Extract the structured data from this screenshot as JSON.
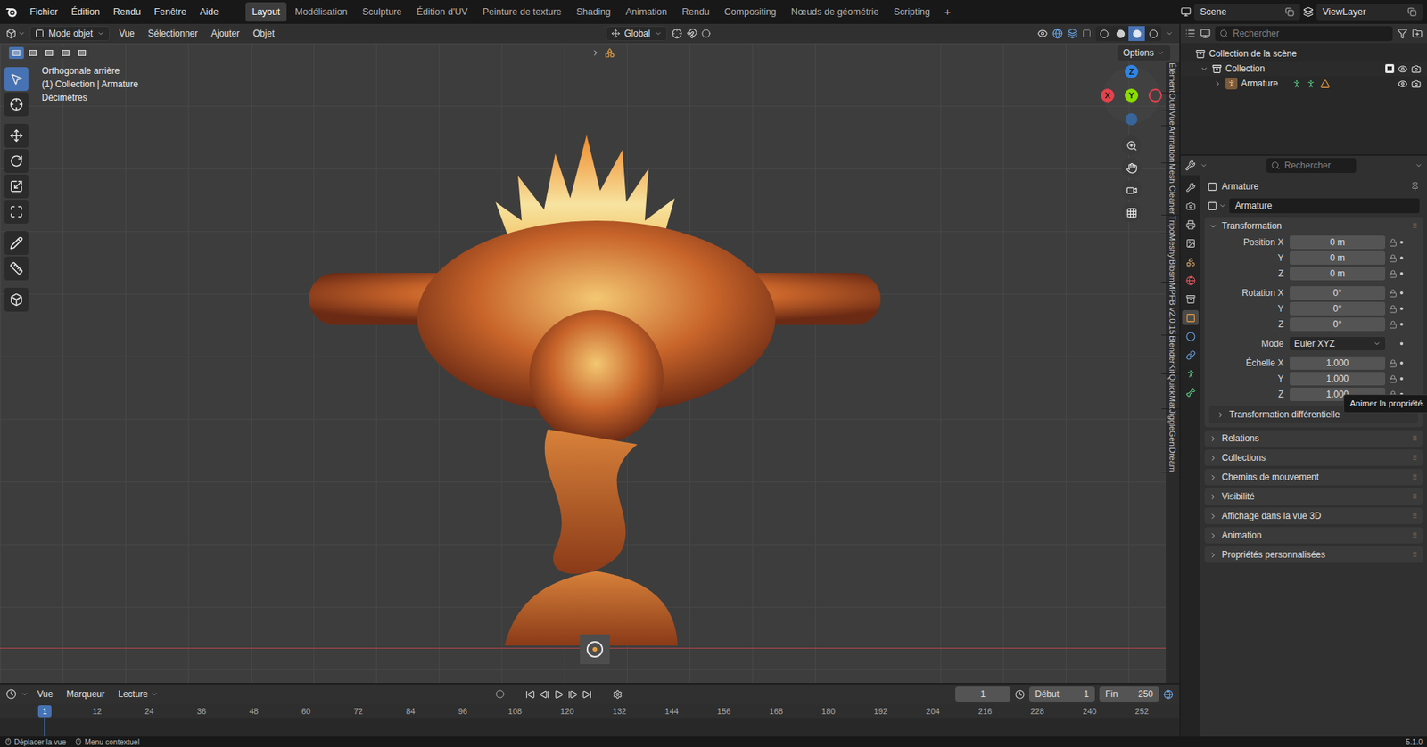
{
  "top_bar": {
    "menu": [
      "Fichier",
      "Édition",
      "Rendu",
      "Fenêtre",
      "Aide"
    ],
    "workspaces": [
      {
        "label": "Layout",
        "selected": true
      },
      {
        "label": "Modélisation",
        "selected": false
      },
      {
        "label": "Sculpture",
        "selected": false
      },
      {
        "label": "Édition d'UV",
        "selected": false
      },
      {
        "label": "Peinture de texture",
        "selected": false
      },
      {
        "label": "Shading",
        "selected": false
      },
      {
        "label": "Animation",
        "selected": false
      },
      {
        "label": "Rendu",
        "selected": false
      },
      {
        "label": "Compositing",
        "selected": false
      },
      {
        "label": "Nœuds de géométrie",
        "selected": false
      },
      {
        "label": "Scripting",
        "selected": false
      }
    ],
    "add_workspace": "+",
    "scene": "Scene",
    "view_layer": "ViewLayer"
  },
  "viewport": {
    "mode": "Mode objet",
    "menus": [
      "Vue",
      "Sélectionner",
      "Ajouter",
      "Objet"
    ],
    "orientation": "Global",
    "options": "Options",
    "select_modes": [
      {
        "selected": true
      },
      {
        "selected": false
      },
      {
        "selected": false
      },
      {
        "selected": false
      },
      {
        "selected": false
      }
    ],
    "shading_modes": [
      {
        "selected": false
      },
      {
        "selected": false
      },
      {
        "selected": true
      },
      {
        "selected": false
      }
    ],
    "overlay": [
      "Orthogonale arrière",
      "(1) Collection | Armature",
      "Décimètres"
    ],
    "gizmo": [
      {
        "label": "X",
        "color": "#e5424c"
      },
      {
        "label": "Y",
        "color": "#8bdc00"
      },
      {
        "label": "Z",
        "color": "#2f84e3"
      }
    ],
    "tools": [
      {
        "selected": true
      },
      {
        "selected": false
      },
      {
        "selected": false
      },
      {
        "selected": false
      },
      {
        "selected": false
      },
      {
        "selected": false
      },
      {
        "selected": false
      },
      {
        "selected": false
      },
      {
        "selected": false
      }
    ],
    "side_tabs": [
      "Élément",
      "Outil",
      "Vue",
      "Animation",
      "Mesh Cleaner",
      "Tripo",
      "Meshy",
      "Blosm",
      "MPFB v2.0.15",
      "BlenderKit",
      "QuickMat",
      "JiggleGen",
      "Dream"
    ]
  },
  "outliner": {
    "search_placeholder": "Rechercher",
    "rows": [
      {
        "label": "Collection de la scène",
        "kind": "scene"
      },
      {
        "label": "Collection",
        "kind": "collection",
        "expanded": true,
        "checked": true,
        "visible": true,
        "renderable": true
      },
      {
        "label": "Armature",
        "kind": "object",
        "expanded": false,
        "visible": true,
        "renderable": true
      }
    ]
  },
  "properties": {
    "search_placeholder": "Rechercher",
    "tabs": [
      {
        "selected": false
      },
      {
        "selected": false
      },
      {
        "selected": false
      },
      {
        "selected": false
      },
      {
        "selected": false
      },
      {
        "selected": false
      },
      {
        "selected": false
      },
      {
        "selected": true
      },
      {
        "selected": false
      },
      {
        "selected": false
      },
      {
        "selected": false
      },
      {
        "selected": false
      }
    ],
    "object_title": "Armature",
    "object_name": "Armature",
    "transform": {
      "title": "Transformation",
      "expanded": true,
      "groups": [
        {
          "rows": [
            {
              "label": "Position X",
              "value": "0 m",
              "kind": "number"
            },
            {
              "label": "Y",
              "value": "0 m",
              "kind": "number"
            },
            {
              "label": "Z",
              "value": "0 m",
              "kind": "number"
            }
          ]
        },
        {
          "rows": [
            {
              "label": "Rotation X",
              "value": "0°",
              "kind": "number"
            },
            {
              "label": "Y",
              "value": "0°",
              "kind": "number"
            },
            {
              "label": "Z",
              "value": "0°",
              "kind": "number"
            }
          ]
        },
        {
          "rows": [
            {
              "label": "Mode",
              "value": "Euler XYZ",
              "kind": "dropdown"
            }
          ]
        },
        {
          "rows": [
            {
              "label": "Échelle X",
              "value": "1.000",
              "kind": "number"
            },
            {
              "label": "Y",
              "value": "1.000",
              "kind": "number"
            },
            {
              "label": "Z",
              "value": "1.000",
              "kind": "number"
            }
          ]
        }
      ],
      "subpanel": {
        "label": "Transformation différentielle",
        "expanded": false
      }
    },
    "panels": [
      {
        "label": "Relations",
        "expanded": false
      },
      {
        "label": "Collections",
        "expanded": false
      },
      {
        "label": "Chemins de mouvement",
        "expanded": false
      },
      {
        "label": "Visibilité",
        "expanded": false
      },
      {
        "label": "Affichage dans la vue 3D",
        "expanded": false
      },
      {
        "label": "Animation",
        "expanded": false
      },
      {
        "label": "Propriétés personnalisées",
        "expanded": false
      }
    ],
    "tooltip": "Animer la propriété."
  },
  "timeline": {
    "menus": [
      "Vue",
      "Marqueur",
      "Lecture"
    ],
    "current_frame": "1",
    "start_label": "Début",
    "start": "1",
    "end_label": "Fin",
    "end": "250",
    "ruler": [
      {
        "label": "1",
        "selected": true
      },
      {
        "label": "12",
        "selected": false
      },
      {
        "label": "24",
        "selected": false
      },
      {
        "label": "36",
        "selected": false
      },
      {
        "label": "48",
        "selected": false
      },
      {
        "label": "60",
        "selected": false
      },
      {
        "label": "72",
        "selected": false
      },
      {
        "label": "84",
        "selected": false
      },
      {
        "label": "96",
        "selected": false
      },
      {
        "label": "108",
        "selected": false
      },
      {
        "label": "120",
        "selected": false
      },
      {
        "label": "132",
        "selected": false
      },
      {
        "label": "144",
        "selected": false
      },
      {
        "label": "156",
        "selected": false
      },
      {
        "label": "168",
        "selected": false
      },
      {
        "label": "180",
        "selected": false
      },
      {
        "label": "192",
        "selected": false
      },
      {
        "label": "204",
        "selected": false
      },
      {
        "label": "216",
        "selected": false
      },
      {
        "label": "228",
        "selected": false
      },
      {
        "label": "240",
        "selected": false
      },
      {
        "label": "252",
        "selected": false
      }
    ]
  },
  "status_bar": {
    "hints": [
      "Déplacer la vue",
      "Menu contextuel"
    ],
    "version": "5.1.0"
  }
}
